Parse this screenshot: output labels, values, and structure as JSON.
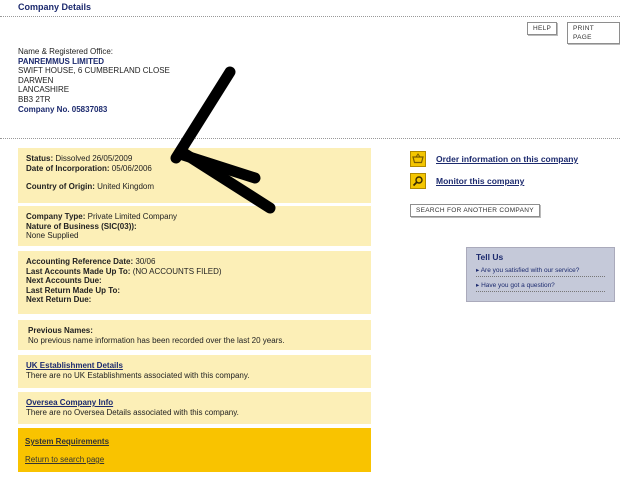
{
  "header": {
    "title": "Company Details",
    "help_label": "HELP",
    "print_label": "PRINT PAGE"
  },
  "office": {
    "heading": "Name & Registered Office:",
    "name": "PANREMMUS LIMITED",
    "address": [
      "SWIFT HOUSE, 6 CUMBERLAND CLOSE",
      "DARWEN",
      "LANCASHIRE",
      "BB3 2TR"
    ],
    "company_no_label": "Company No. 05837083"
  },
  "status": {
    "status_label": "Status:",
    "status_value": "Dissolved 26/05/2009",
    "incorp_label": "Date of Incorporation:",
    "incorp_value": "05/06/2006",
    "country_label": "Country of Origin:",
    "country_value": "United Kingdom"
  },
  "type": {
    "type_label": "Company Type:",
    "type_value": "Private Limited Company",
    "nature_label": "Nature of Business (SIC(03)):",
    "nature_value": "None Supplied"
  },
  "accounts": {
    "ref_label": "Accounting Reference Date:",
    "ref_value": "30/06",
    "last_label": "Last Accounts Made Up To:",
    "last_value": "(NO ACCOUNTS FILED)",
    "next_label": "Next Accounts Due:",
    "last_return_label": "Last Return Made Up To:",
    "next_return_label": "Next Return Due:"
  },
  "previous": {
    "label": "Previous Names:",
    "text": "No previous name information has been recorded over the last 20 years."
  },
  "uk": {
    "link": "UK Establishment Details",
    "text": "There are no UK Establishments associated with this company."
  },
  "oversea": {
    "link": "Oversea Company Info",
    "text": "There are no Oversea Details associated with this company."
  },
  "footer": {
    "system_req": "System Requirements",
    "return": "Return to search page"
  },
  "side": {
    "order_link": "Order information on this company",
    "monitor_link": "Monitor this company",
    "search_button": "SEARCH FOR ANOTHER COMPANY"
  },
  "tellus": {
    "title": "Tell Us",
    "items": [
      "Are you satisfied with our service?",
      "Have you got a question?"
    ]
  },
  "colors": {
    "panel": "#fcefb7",
    "accent": "#f9c300",
    "link": "#1c2a6e"
  }
}
